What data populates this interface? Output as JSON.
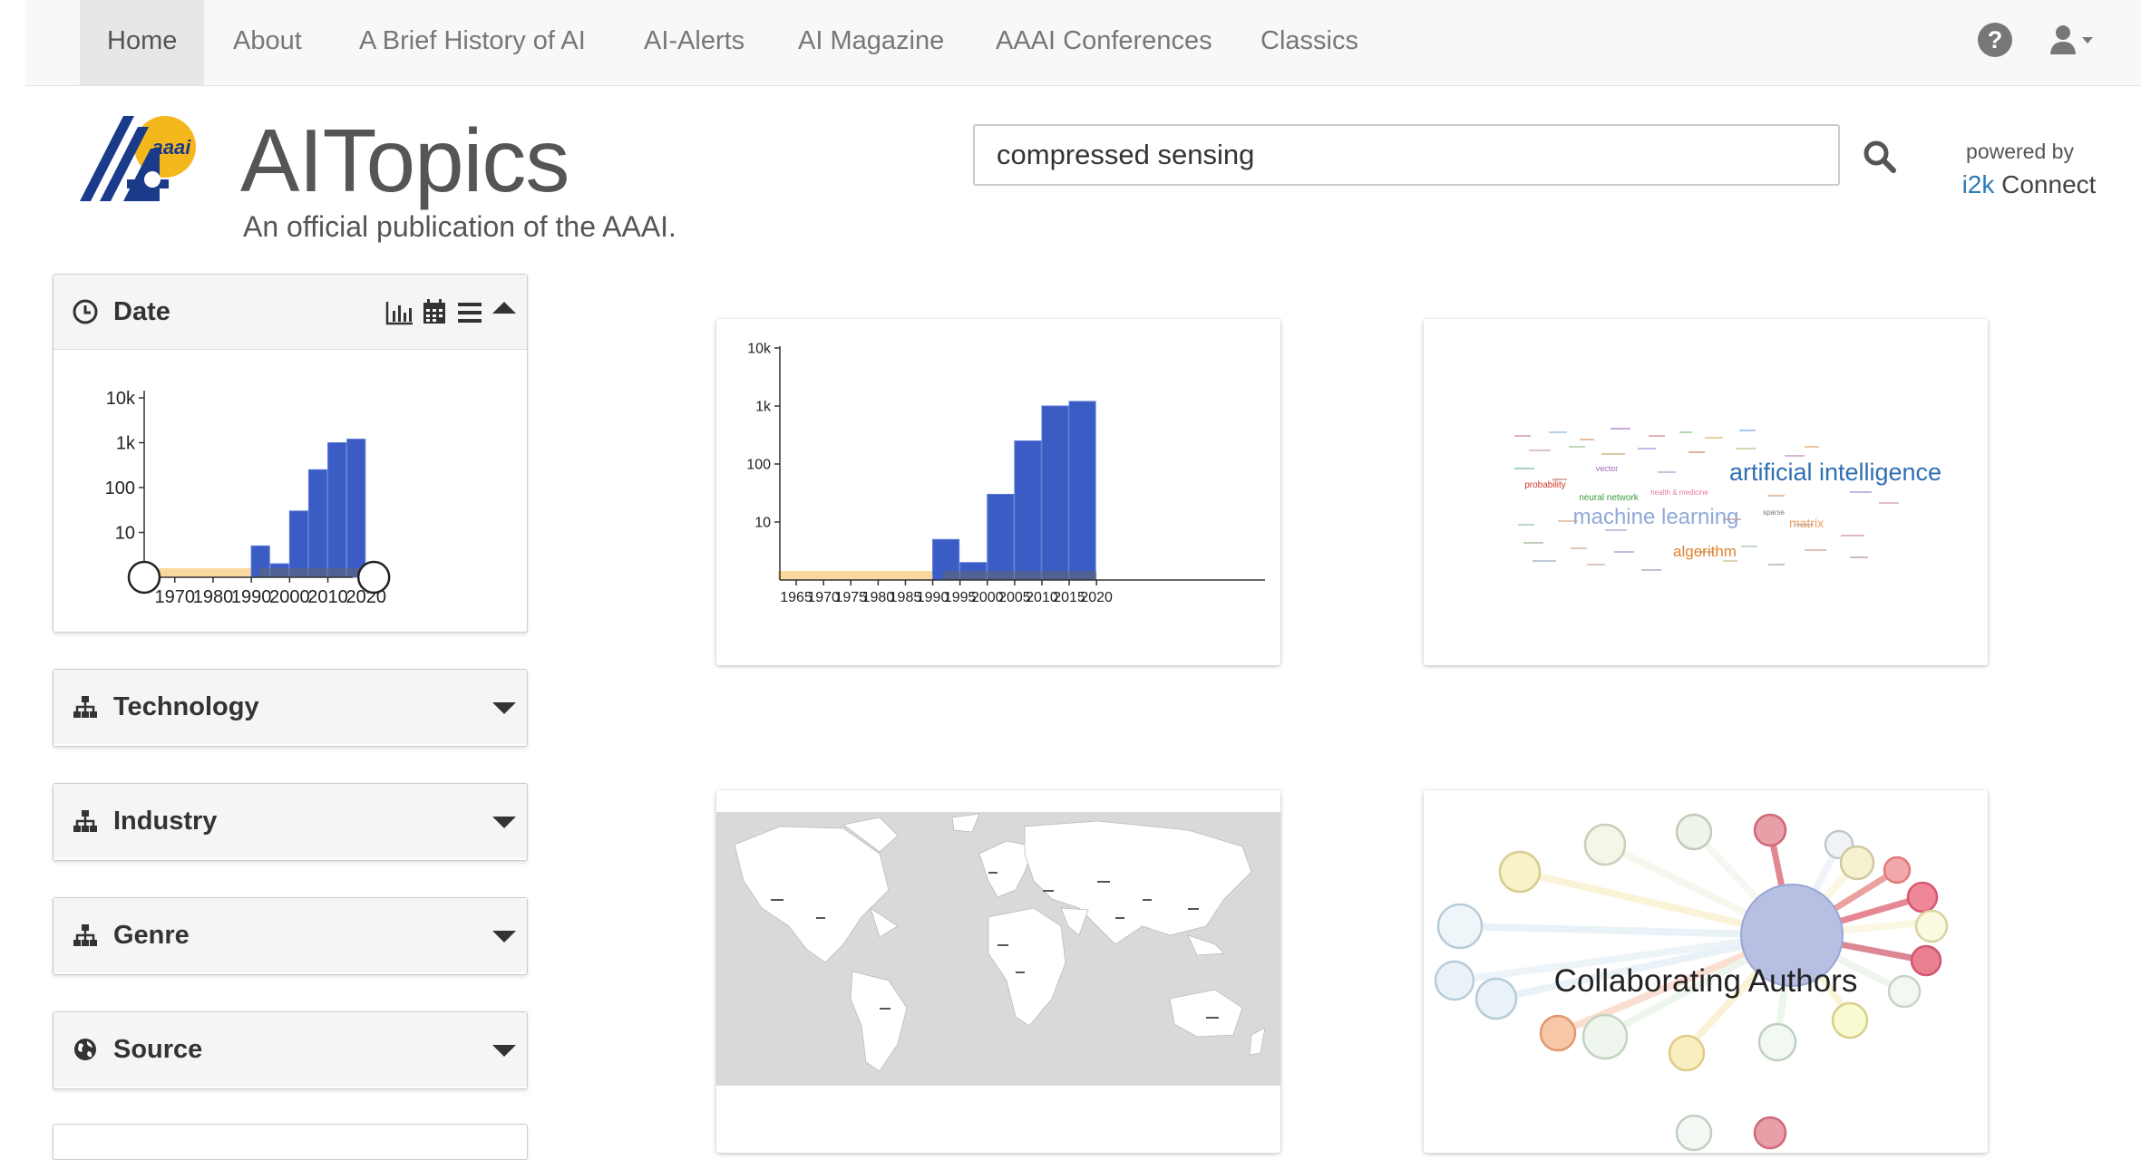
{
  "nav": {
    "items": [
      {
        "label": "Home",
        "active": true
      },
      {
        "label": "About"
      },
      {
        "label": "A Brief History of AI"
      },
      {
        "label": "AI-Alerts"
      },
      {
        "label": "AI Magazine"
      },
      {
        "label": "AAAI Conferences"
      },
      {
        "label": "Classics"
      }
    ],
    "help_icon": "question-circle-icon",
    "user_icon": "user-dropdown-icon"
  },
  "header": {
    "logo_text": "aaai",
    "brand": "AITopics",
    "tagline": "An official publication of the AAAI.",
    "search_value": "compressed sensing",
    "powered_by": "powered by",
    "i2k": "i2k",
    "connect": "Connect"
  },
  "sidebar": {
    "date": {
      "title": "Date",
      "chart_data": {
        "type": "bar",
        "log_scale": true,
        "x": [
          1995,
          2000,
          2005,
          2010,
          2015,
          2020
        ],
        "values": [
          5,
          2,
          30,
          250,
          1000,
          1200
        ],
        "yticks": [
          "10k",
          "1k",
          "100",
          "10"
        ],
        "xticks": [
          "1970",
          "1980",
          "1990",
          "2000",
          "2010",
          "2020"
        ],
        "range_selected": [
          1962,
          2022
        ]
      }
    },
    "panels": [
      {
        "title": "Technology",
        "icon": "sitemap-icon"
      },
      {
        "title": "Industry",
        "icon": "sitemap-icon"
      },
      {
        "title": "Genre",
        "icon": "sitemap-icon"
      },
      {
        "title": "Source",
        "icon": "globe-icon"
      }
    ]
  },
  "cards": {
    "histogram": {
      "chart_data": {
        "type": "bar",
        "log_scale": true,
        "x": [
          1995,
          2000,
          2005,
          2010,
          2015,
          2020
        ],
        "values": [
          5,
          2,
          30,
          250,
          1000,
          1200
        ],
        "yticks": [
          "10k",
          "1k",
          "100",
          "10"
        ],
        "xticks": [
          "1965",
          "1970",
          "1975",
          "1980",
          "1985",
          "1990",
          "1995",
          "2000",
          "2005",
          "2010",
          "2015",
          "2020"
        ]
      }
    },
    "wordcloud": {
      "words": [
        {
          "text": "artificial intelligence",
          "color": "#2f6fb3"
        },
        {
          "text": "machine learning",
          "color": "#8fa9d9"
        },
        {
          "text": "algorithm",
          "color": "#e0822f"
        },
        {
          "text": "matrix",
          "color": "#e8a060"
        },
        {
          "text": "probability",
          "color": "#d0392b"
        },
        {
          "text": "neural network",
          "color": "#3b9a3b"
        },
        {
          "text": "vector",
          "color": "#9c6bbf"
        },
        {
          "text": "health & medicine",
          "color": "#e8799a"
        },
        {
          "text": "sparse",
          "color": "#777777"
        }
      ]
    },
    "authors": {
      "label": "Collaborating Authors"
    }
  },
  "colors": {
    "bar": "#3a5cc4",
    "range": "#f9d9a0",
    "nav_bg": "#f8f8f8"
  }
}
